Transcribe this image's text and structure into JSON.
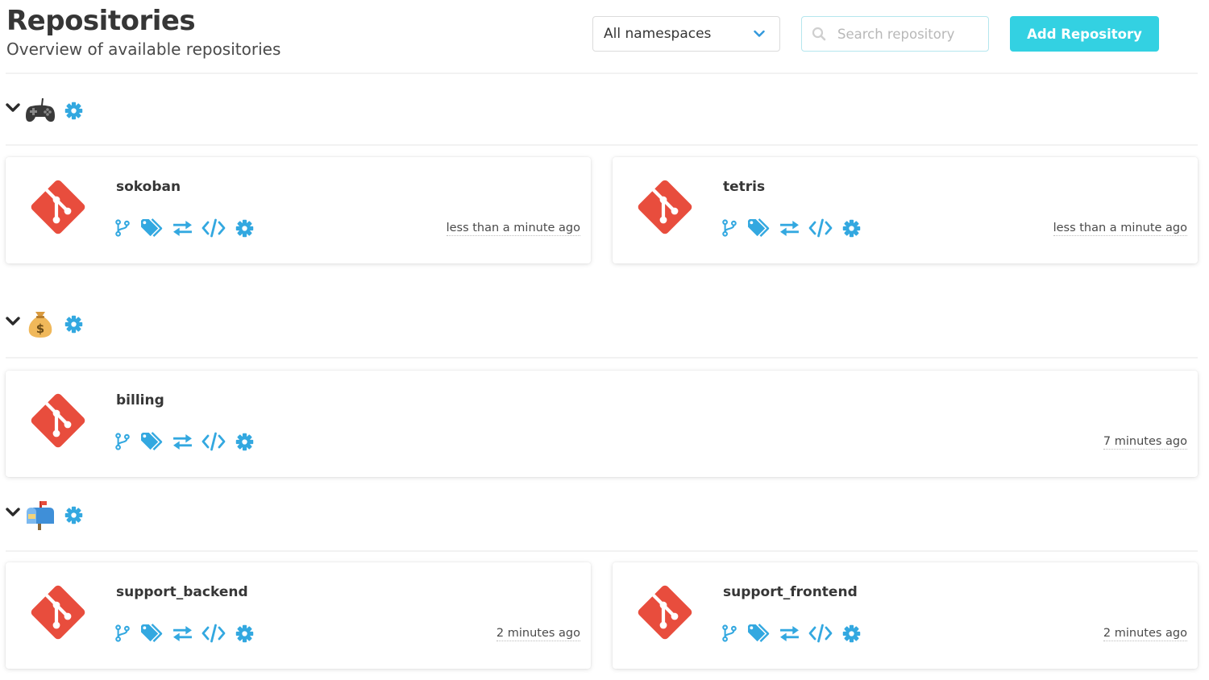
{
  "header": {
    "title": "Repositories",
    "subtitle": "Overview of available repositories",
    "namespace_select": "All namespaces",
    "search_placeholder": "Search repository",
    "add_button": "Add Repository"
  },
  "colors": {
    "accent": "#33d1e2",
    "icon_blue": "#33a8e0",
    "git_red": "#e84d3d"
  },
  "namespaces": [
    {
      "emoji": "video-game-controller-icon",
      "repos": [
        {
          "name": "sokoban",
          "date": "less than a minute ago"
        },
        {
          "name": "tetris",
          "date": "less than a minute ago"
        }
      ]
    },
    {
      "emoji": "money-bag-icon",
      "repos": [
        {
          "name": "billing",
          "date": "7 minutes ago"
        }
      ]
    },
    {
      "emoji": "mailbox-icon",
      "repos": [
        {
          "name": "support_backend",
          "date": "2 minutes ago"
        },
        {
          "name": "support_frontend",
          "date": "2 minutes ago"
        }
      ]
    }
  ],
  "repo_actions": [
    "branches-icon",
    "tags-icon",
    "changesets-icon",
    "sources-icon",
    "settings-icon"
  ]
}
